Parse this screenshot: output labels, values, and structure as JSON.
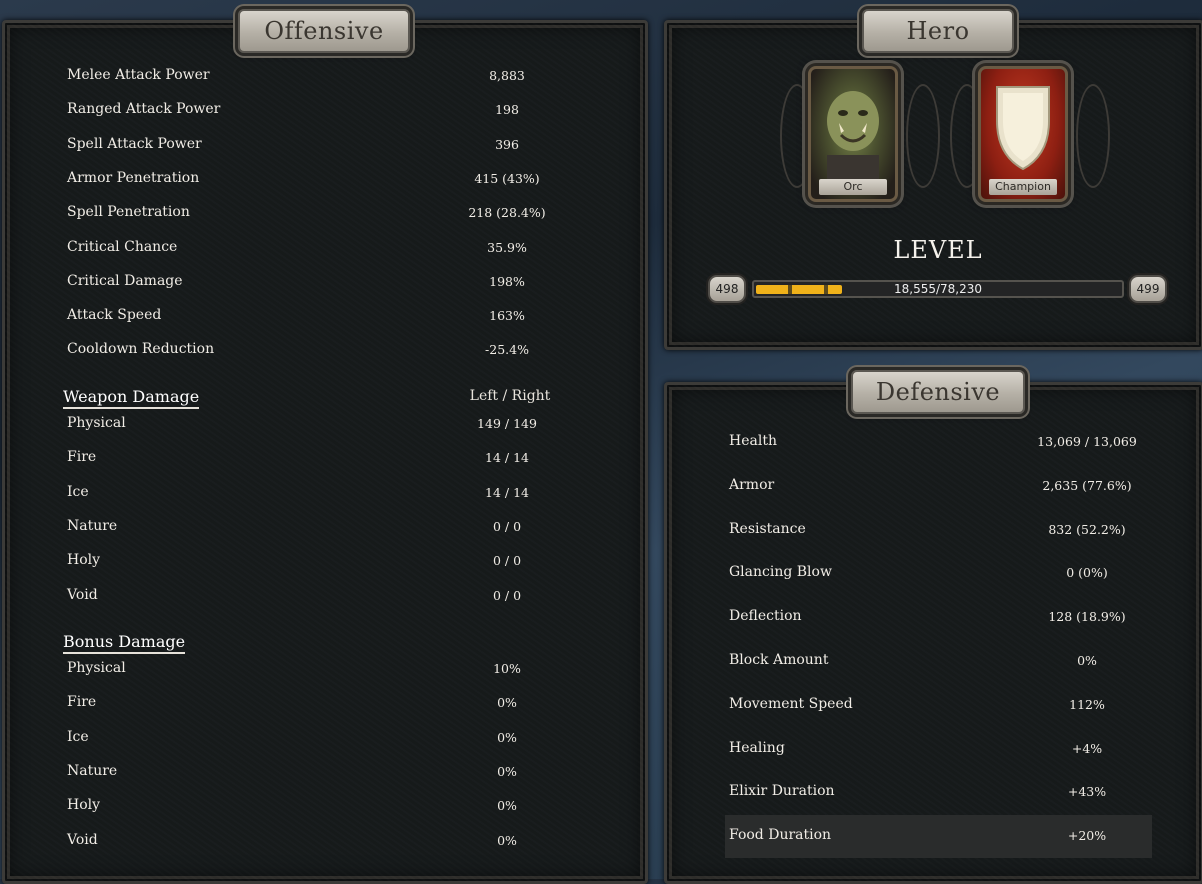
{
  "offensive": {
    "title": "Offensive",
    "stats": [
      {
        "label": "Melee Attack Power",
        "value": "8,883"
      },
      {
        "label": "Ranged Attack Power",
        "value": "198"
      },
      {
        "label": "Spell Attack Power",
        "value": "396"
      },
      {
        "label": "Armor Penetration",
        "value": "415 (43%)"
      },
      {
        "label": "Spell Penetration",
        "value": "218 (28.4%)"
      },
      {
        "label": "Critical Chance",
        "value": "35.9%"
      },
      {
        "label": "Critical Damage",
        "value": "198%"
      },
      {
        "label": "Attack Speed",
        "value": "163%"
      },
      {
        "label": "Cooldown Reduction",
        "value": "-25.4%"
      }
    ],
    "weapon_damage": {
      "heading": "Weapon Damage",
      "column_label": "Left / Right",
      "rows": [
        {
          "label": "Physical",
          "value": "149 / 149"
        },
        {
          "label": "Fire",
          "value": "14 / 14"
        },
        {
          "label": "Ice",
          "value": "14 / 14"
        },
        {
          "label": "Nature",
          "value": "0 / 0"
        },
        {
          "label": "Holy",
          "value": "0 / 0"
        },
        {
          "label": "Void",
          "value": "0 / 0"
        }
      ]
    },
    "bonus_damage": {
      "heading": "Bonus Damage",
      "rows": [
        {
          "label": "Physical",
          "value": "10%"
        },
        {
          "label": "Fire",
          "value": "0%"
        },
        {
          "label": "Ice",
          "value": "0%"
        },
        {
          "label": "Nature",
          "value": "0%"
        },
        {
          "label": "Holy",
          "value": "0%"
        },
        {
          "label": "Void",
          "value": "0%"
        }
      ]
    }
  },
  "hero": {
    "title": "Hero",
    "race_label": "Orc",
    "class_label": "Champion",
    "level_heading": "LEVEL",
    "current_level": "498",
    "next_level": "499",
    "xp_text": "18,555/78,230",
    "xp_fraction": 0.237
  },
  "defensive": {
    "title": "Defensive",
    "stats": [
      {
        "label": "Health",
        "value": "13,069 / 13,069"
      },
      {
        "label": "Armor",
        "value": "2,635 (77.6%)"
      },
      {
        "label": "Resistance",
        "value": "832 (52.2%)"
      },
      {
        "label": "Glancing Blow",
        "value": "0 (0%)"
      },
      {
        "label": "Deflection",
        "value": "128 (18.9%)"
      },
      {
        "label": "Block Amount",
        "value": "0%"
      },
      {
        "label": "Movement Speed",
        "value": "112%"
      },
      {
        "label": "Healing",
        "value": "+4%"
      },
      {
        "label": "Elixir Duration",
        "value": "+43%"
      },
      {
        "label": "Food Duration",
        "value": "+20%"
      }
    ]
  },
  "colors": {
    "xp_bar": "#f0b21a",
    "panel_bg": "#161a1b",
    "plate": "#c8c4bb"
  }
}
